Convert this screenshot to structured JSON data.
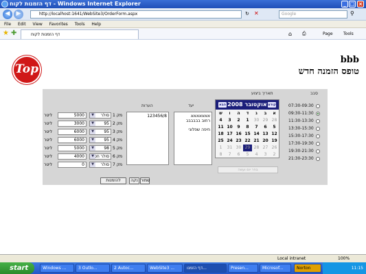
{
  "window": {
    "title": "דף הזמנות לקוח - Windows Internet Explorer"
  },
  "address": {
    "url": "http://localhost:1641/WebSite3/OrderForm.aspx",
    "search_placeholder": "Google"
  },
  "menu": [
    "File",
    "Edit",
    "View",
    "Favorites",
    "Tools",
    "Help"
  ],
  "tab": {
    "label": "דף הזמנות לקוח"
  },
  "toolbar": {
    "page": "Page",
    "tools": "Tools"
  },
  "header": {
    "logo": "Top",
    "user": "bbb",
    "title": "טופס הזמנה חדש"
  },
  "form": {
    "slot_header": "סבב",
    "date_header": "תאריך ביצוע",
    "slots": [
      {
        "label": "07:30-09:30",
        "selected": false
      },
      {
        "label": "09:30-11:30",
        "selected": true
      },
      {
        "label": "11:30-13:30",
        "selected": false
      },
      {
        "label": "13:30-15:30",
        "selected": false
      },
      {
        "label": "15:30-17:30",
        "selected": false
      },
      {
        "label": "17:30-19:30",
        "selected": false
      },
      {
        "label": "19:30-21:30",
        "selected": false
      },
      {
        "label": "21:30-23:30",
        "selected": false
      }
    ],
    "calendar": {
      "title": "אוקטובר 2008",
      "prev": "קודם",
      "next": "הבא",
      "weekdays": [
        "א",
        "ב",
        "ג",
        "ד",
        "ה",
        "ו",
        "ש"
      ],
      "rows": [
        [
          "28",
          "29",
          "30",
          "1",
          "2",
          "3",
          "4"
        ],
        [
          "5",
          "6",
          "7",
          "8",
          "9",
          "10",
          "11"
        ],
        [
          "12",
          "13",
          "14",
          "15",
          "16",
          "17",
          "18"
        ],
        [
          "19",
          "20",
          "21",
          "22",
          "23",
          "24",
          "25"
        ],
        [
          "26",
          "27",
          "28",
          "29",
          "30",
          "31",
          "1"
        ],
        [
          "2",
          "3",
          "4",
          "5",
          "6",
          "7",
          "8"
        ]
      ],
      "selected": "29",
      "clear_button": "בחר יום ועשה"
    },
    "notes_header": "הערות",
    "notes_text": "123456/8",
    "dest_header": "יעד",
    "dest_lines": [
      "אאאאאאא",
      "רחוב בבבבבב",
      "חיפה שפלוני"
    ],
    "item_prefix": "מק",
    "unit_label": "ליטר",
    "items": [
      {
        "n": "1",
        "product": "סולר",
        "qty": "5000"
      },
      {
        "n": "2",
        "product": "95",
        "qty": "3000"
      },
      {
        "n": "3",
        "product": "95",
        "qty": "6000"
      },
      {
        "n": "4",
        "product": "95",
        "qty": "6000"
      },
      {
        "n": "5",
        "product": "98",
        "qty": "5000"
      },
      {
        "n": "6",
        "product": "סולר חסכ",
        "qty": "4000"
      },
      {
        "n": "7",
        "product": "סולר",
        "qty": "0"
      }
    ],
    "buttons": {
      "save": "שמור",
      "clear": "נקה",
      "orders": "להזמנות"
    }
  },
  "status": {
    "text": "Local intranet",
    "zoom": "100%"
  },
  "taskbar": {
    "start": "start",
    "tasks": [
      "Windows ...",
      "3 Outlo...",
      "2 Autoc...",
      "WebSite3 ...",
      "דף הזמנו...",
      "Presen...",
      "Microsof..."
    ],
    "norton": "Norton",
    "clock": "11:15"
  },
  "colors": {
    "calendar_header": "#1b1e7a",
    "panel": "#d6d6d6",
    "logo": "#d01818"
  }
}
